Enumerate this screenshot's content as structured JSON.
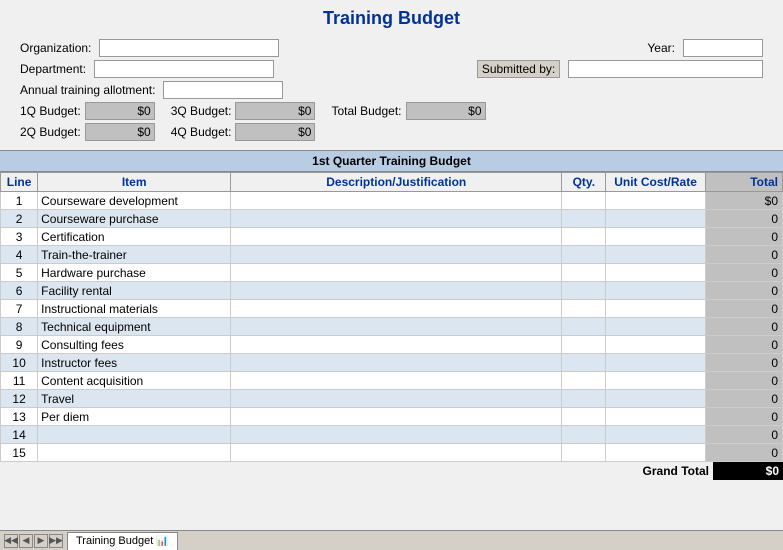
{
  "title": "Training Budget",
  "header": {
    "organization_label": "Organization:",
    "year_label": "Year:",
    "department_label": "Department:",
    "submitted_by_label": "Submitted by:",
    "annual_allotment_label": "Annual training allotment:",
    "q1_budget_label": "1Q Budget:",
    "q2_budget_label": "2Q Budget:",
    "q3_budget_label": "3Q Budget:",
    "q4_budget_label": "4Q Budget:",
    "total_budget_label": "Total Budget:",
    "q1_value": "$0",
    "q2_value": "$0",
    "q3_value": "$0",
    "q4_value": "$0",
    "total_value": "$0"
  },
  "section_title": "1st Quarter Training Budget",
  "table": {
    "col_line": "Line",
    "col_item": "Item",
    "col_desc": "Description/Justification",
    "col_qty": "Qty.",
    "col_rate": "Unit Cost/Rate",
    "col_total": "Total",
    "rows": [
      {
        "line": "1",
        "item": "Courseware development",
        "total": "$0"
      },
      {
        "line": "2",
        "item": "Courseware purchase",
        "total": "0"
      },
      {
        "line": "3",
        "item": "Certification",
        "total": "0"
      },
      {
        "line": "4",
        "item": "Train-the-trainer",
        "total": "0"
      },
      {
        "line": "5",
        "item": "Hardware purchase",
        "total": "0"
      },
      {
        "line": "6",
        "item": "Facility rental",
        "total": "0"
      },
      {
        "line": "7",
        "item": "Instructional materials",
        "total": "0"
      },
      {
        "line": "8",
        "item": "Technical equipment",
        "total": "0"
      },
      {
        "line": "9",
        "item": "Consulting fees",
        "total": "0"
      },
      {
        "line": "10",
        "item": "Instructor fees",
        "total": "0"
      },
      {
        "line": "11",
        "item": "Content acquisition",
        "total": "0"
      },
      {
        "line": "12",
        "item": "Travel",
        "total": "0"
      },
      {
        "line": "13",
        "item": "Per diem",
        "total": "0"
      },
      {
        "line": "14",
        "item": "",
        "total": "0"
      },
      {
        "line": "15",
        "item": "",
        "total": "0"
      }
    ]
  },
  "grand_total_label": "Grand Total",
  "grand_total_value": "$0",
  "taskbar": {
    "tab_label": "Training Budget"
  }
}
